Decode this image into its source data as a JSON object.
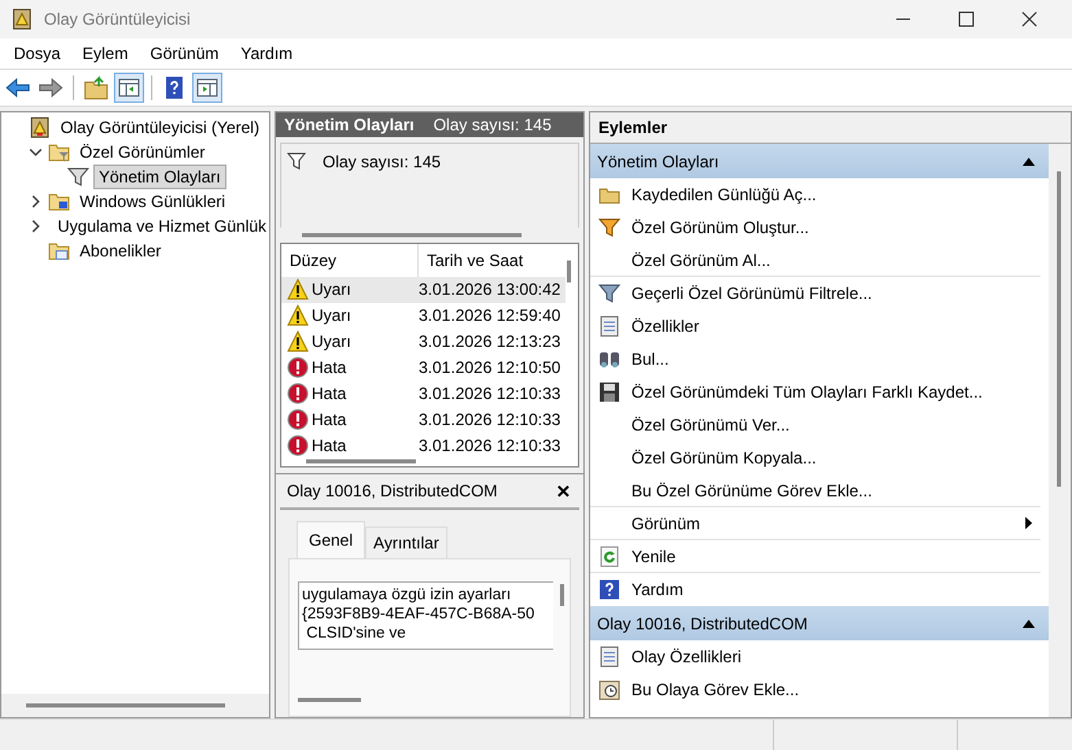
{
  "window": {
    "title": "Olay Görüntüleyicisi"
  },
  "menu": [
    "Dosya",
    "Eylem",
    "Görünüm",
    "Yardım"
  ],
  "tree": [
    {
      "label": "Olay Görüntüleyicisi (Yerel)",
      "kind": "root",
      "selected": false,
      "children": [
        {
          "label": "Özel Görünümler",
          "kind": "views",
          "selected": false,
          "expanded": true,
          "children": [
            {
              "label": "Yönetim Olayları",
              "kind": "filter",
              "selected": true
            }
          ]
        },
        {
          "label": "Windows Günlükleri",
          "kind": "logs",
          "selected": false,
          "expanded": false
        },
        {
          "label": "Uygulama ve Hizmet Günlük",
          "kind": "app",
          "selected": false,
          "expanded": false
        },
        {
          "label": "Abonelikler",
          "kind": "subs",
          "selected": false
        }
      ]
    }
  ],
  "center": {
    "title": "Yönetim Olayları",
    "count": "Olay sayısı: 145",
    "filter_text": "Olay sayısı: 145",
    "columns": [
      "Düzey",
      "Tarih ve Saat"
    ],
    "rows": [
      {
        "kind": "warning",
        "level": "Uyarı",
        "date": "3.01.2026 13:00:42",
        "selected": true
      },
      {
        "kind": "warning",
        "level": "Uyarı",
        "date": "3.01.2026 12:59:40",
        "selected": false
      },
      {
        "kind": "warning",
        "level": "Uyarı",
        "date": "3.01.2026 12:13:23",
        "selected": false
      },
      {
        "kind": "error",
        "level": "Hata",
        "date": "3.01.2026 12:10:50",
        "selected": false
      },
      {
        "kind": "error",
        "level": "Hata",
        "date": "3.01.2026 12:10:33",
        "selected": false
      },
      {
        "kind": "error",
        "level": "Hata",
        "date": "3.01.2026 12:10:33",
        "selected": false
      },
      {
        "kind": "error",
        "level": "Hata",
        "date": "3.01.2026 12:10:33",
        "selected": false
      }
    ]
  },
  "detail": {
    "title": "Olay 10016, DistributedCOM",
    "close": "✕",
    "tabs": [
      {
        "label": "Genel",
        "selected": true
      },
      {
        "label": "Ayrıntılar",
        "selected": false
      }
    ],
    "lines": [
      "uygulamaya özgü izin ayarları",
      "{2593F8B9-4EAF-457C-B68A-50",
      " CLSID'sine ve"
    ]
  },
  "actions": {
    "title": "Eylemler",
    "sections": [
      {
        "title": "Yönetim Olayları",
        "expanded": true,
        "items": [
          {
            "label": "Kaydedilen Günlüğü Aç...",
            "kind": "action",
            "separator_after": false
          },
          {
            "label": "Özel Görünüm Oluştur...",
            "kind": "action",
            "separator_after": false
          },
          {
            "label": "Özel Görünüm Al...",
            "kind": "action",
            "separator_after": true
          },
          {
            "label": "Geçerli Özel Görünümü Filtrele...",
            "kind": "action",
            "separator_after": false
          },
          {
            "label": "Özellikler",
            "kind": "action",
            "separator_after": false
          },
          {
            "label": "Bul...",
            "kind": "action",
            "separator_after": false
          },
          {
            "label": "Özel Görünümdeki Tüm Olayları Farklı Kaydet...",
            "kind": "action",
            "separator_after": false
          },
          {
            "label": "Özel Görünümü Ver...",
            "kind": "action",
            "separator_after": false
          },
          {
            "label": "Özel Görünüm Kopyala...",
            "kind": "action",
            "separator_after": false
          },
          {
            "label": "Bu Özel Görünüme Görev Ekle...",
            "kind": "action",
            "separator_after": true
          },
          {
            "label": "Görünüm",
            "kind": "submenu",
            "separator_after": true
          },
          {
            "label": "Yenile",
            "kind": "action",
            "separator_after": true
          },
          {
            "label": "Yardım",
            "kind": "action",
            "separator_after": false
          }
        ]
      },
      {
        "title": "Olay 10016, DistributedCOM",
        "expanded": true,
        "items": [
          {
            "label": "Olay Özellikleri",
            "kind": "action",
            "separator_after": false
          },
          {
            "label": "Bu Olaya Görev Ekle...",
            "kind": "action",
            "separator_after": false
          }
        ]
      }
    ]
  }
}
